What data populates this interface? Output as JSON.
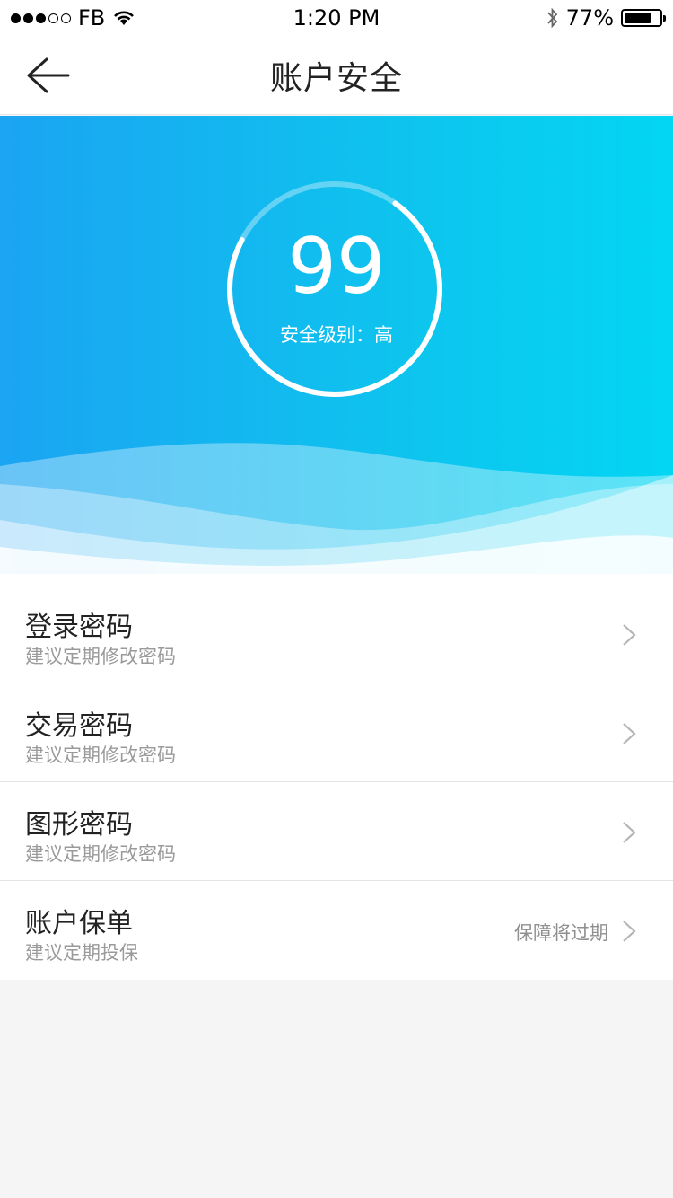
{
  "status_bar": {
    "carrier": "FB",
    "time": "1:20 PM",
    "battery": "77%",
    "battery_level": 0.77,
    "signal_bars": 3,
    "signal_total": 5
  },
  "nav": {
    "title": "账户安全",
    "back_icon": "arrow-left-icon"
  },
  "hero": {
    "score": "99",
    "score_value": 99,
    "level_label": "安全级别：高",
    "ring_progress": 0.99,
    "colors": {
      "gradient_start": "#1ba4f2",
      "gradient_end": "#03d6f3"
    }
  },
  "items": [
    {
      "title": "登录密码",
      "subtitle": "建议定期修改密码",
      "extra": ""
    },
    {
      "title": "交易密码",
      "subtitle": "建议定期修改密码",
      "extra": ""
    },
    {
      "title": "图形密码",
      "subtitle": "建议定期修改密码",
      "extra": ""
    },
    {
      "title": "账户保单",
      "subtitle": "建议定期投保",
      "extra": "保障将过期"
    }
  ]
}
